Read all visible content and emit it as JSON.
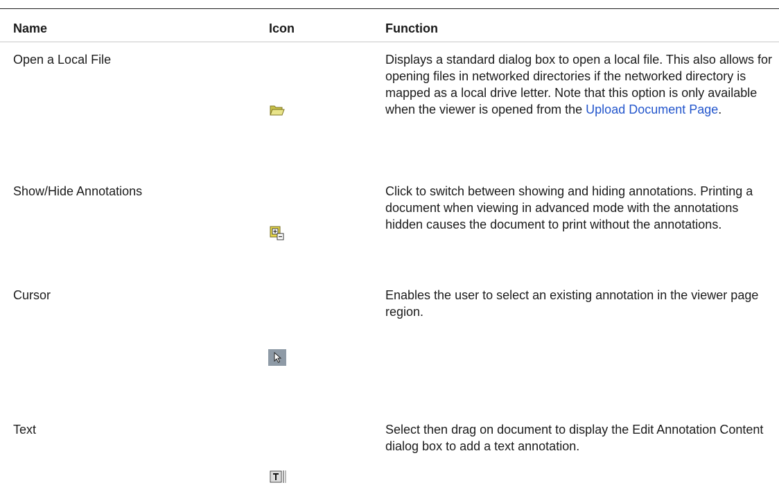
{
  "table": {
    "headers": {
      "name": "Name",
      "icon": "Icon",
      "function": "Function"
    },
    "rows": [
      {
        "name": "Open a Local File",
        "icon": "open-folder-icon",
        "function_before_link": "Displays a standard dialog box to open a local file. This also allows for opening files in networked directories if the networked directory is mapped as a local drive letter. Note that this option is only available when the viewer is opened from the ",
        "function_link": "Upload Document Page",
        "function_after_link": "."
      },
      {
        "name": "Show/Hide Annotations",
        "icon": "show-hide-annotations-icon",
        "function": "Click to switch between showing and hiding annotations. Printing a document when viewing in advanced mode with the annotations hidden causes the document to print without the annotations."
      },
      {
        "name": "Cursor",
        "icon": "cursor-arrow-icon",
        "function": "Enables the user to select an existing annotation in the viewer page region."
      },
      {
        "name": "Text",
        "icon": "text-annotation-icon",
        "function": "Select then drag on document to display the Edit Annotation Content dialog box to add a text annotation."
      }
    ]
  },
  "colors": {
    "link": "#2255cc",
    "text": "#1a1a1a",
    "rule": "#1a1a1a"
  }
}
